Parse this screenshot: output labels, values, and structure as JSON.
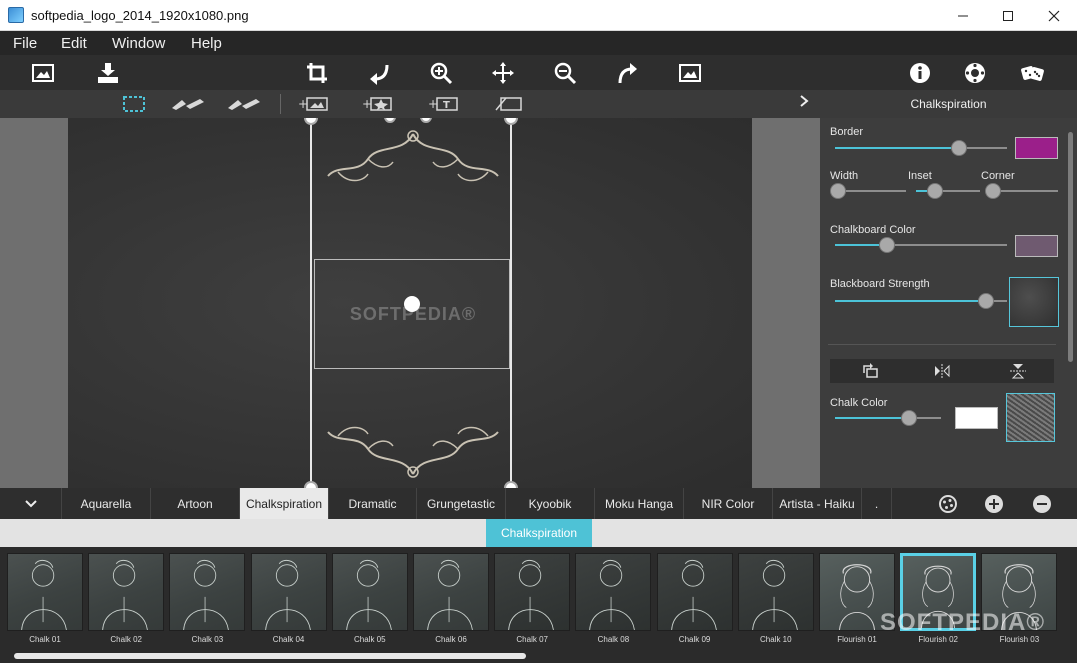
{
  "window": {
    "title": "softpedia_logo_2014_1920x1080.png"
  },
  "menu": [
    "File",
    "Edit",
    "Window",
    "Help"
  ],
  "panel": {
    "title": "Chalkspiration",
    "border_label": "Border",
    "border_color": "#9b1f8a",
    "width_label": "Width",
    "inset_label": "Inset",
    "corner_label": "Corner",
    "chalkboard_color_label": "Chalkboard Color",
    "chalkboard_color": "#6f5a70",
    "blackboard_strength_label": "Blackboard Strength",
    "chalk_color_label": "Chalk Color",
    "chalk_color": "#ffffff",
    "sliders": {
      "border": 0.72,
      "width": 0.05,
      "inset": 0.3,
      "corner": 0.1,
      "chalkboard_color": 0.3,
      "blackboard_strength": 0.88,
      "chalk_color": 0.7
    }
  },
  "canvas": {
    "watermark": "SOFTPEDIA®"
  },
  "tabs": [
    "Aquarella",
    "Artoon",
    "Chalkspiration",
    "Dramatic",
    "Grungetastic",
    "Kyoobik",
    "Moku Hanga",
    "NIR Color",
    "Artista - Haiku",
    "."
  ],
  "active_tab": "Chalkspiration",
  "preset_group": "Chalkspiration",
  "thumbnails": [
    "Chalk 01",
    "Chalk 02",
    "Chalk 03",
    "Chalk 04",
    "Chalk 05",
    "Chalk 06",
    "Chalk 07",
    "Chalk 08",
    "Chalk 09",
    "Chalk 10",
    "Flourish 01",
    "Flourish 02",
    "Flourish 03"
  ],
  "selected_thumbnail": "Flourish 02",
  "watermark_strip": "SOFTPEDIA®",
  "accent_color": "#4ec2d6"
}
